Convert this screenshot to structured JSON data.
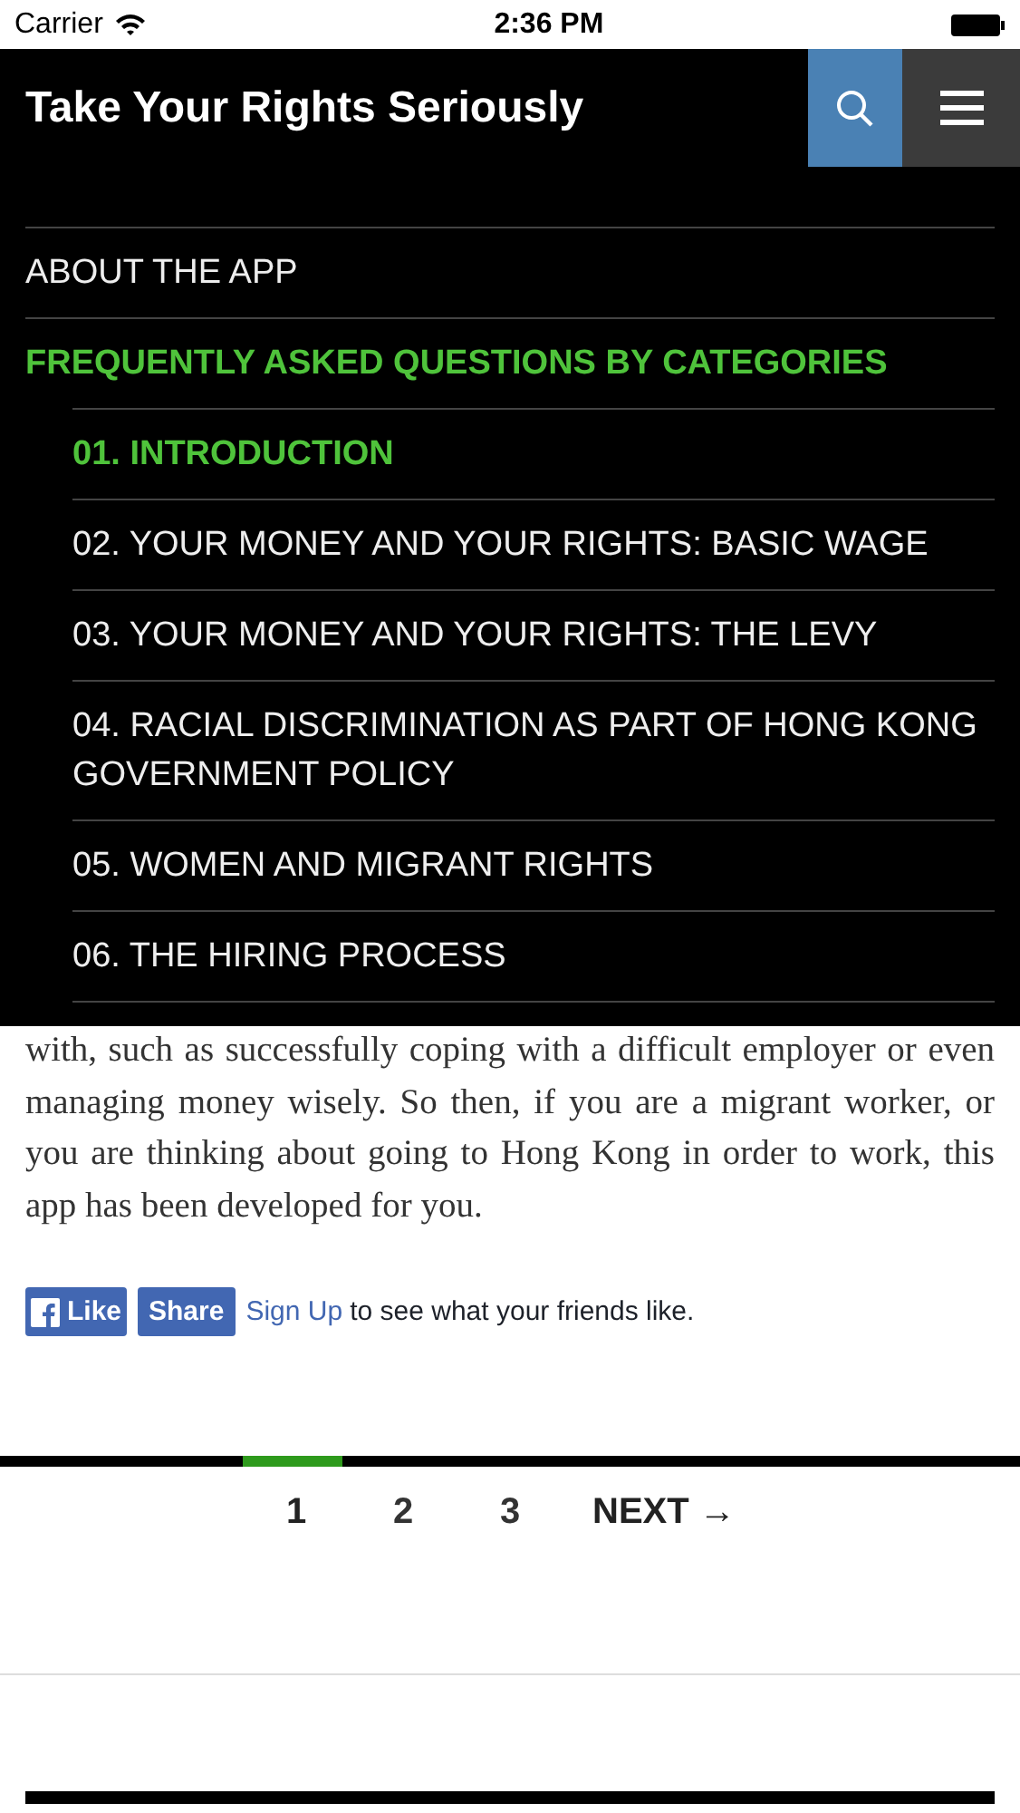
{
  "status_bar": {
    "carrier": "Carrier",
    "time": "2:36 PM"
  },
  "header": {
    "title": "Take Your Rights Seriously"
  },
  "menu": [
    {
      "label": "ABOUT THE APP",
      "active": false
    },
    {
      "label": "FREQUENTLY ASKED QUESTIONS BY CATEGORIES",
      "active": true,
      "children": [
        {
          "label": "01. INTRODUCTION",
          "active": true
        },
        {
          "label": "02. YOUR MONEY AND YOUR RIGHTS: BASIC WAGE",
          "active": false
        },
        {
          "label": "03. YOUR MONEY AND YOUR RIGHTS: THE LEVY",
          "active": false
        },
        {
          "label": "04. RACIAL DISCRIMINATION AS PART OF HONG KONG GOVERNMENT POLICY",
          "active": false
        },
        {
          "label": "05. WOMEN AND MIGRANT RIGHTS",
          "active": false
        },
        {
          "label": "06. THE HIRING PROCESS",
          "active": false
        }
      ]
    }
  ],
  "body": {
    "paragraph": "with, such as successfully coping with a difficult employer or even managing money wisely. So then, if you are a migrant worker, or you are thinking about going to Hong Kong in order to work, this app has been developed for you."
  },
  "social": {
    "like": "Like",
    "share": "Share",
    "signup": "Sign Up",
    "text": "to see what your friends like."
  },
  "pagination": {
    "pages": [
      {
        "label": "1",
        "selected": true
      },
      {
        "label": "2",
        "selected": false
      },
      {
        "label": "3",
        "selected": false
      }
    ],
    "next": "NEXT",
    "next_arrow": "→"
  }
}
